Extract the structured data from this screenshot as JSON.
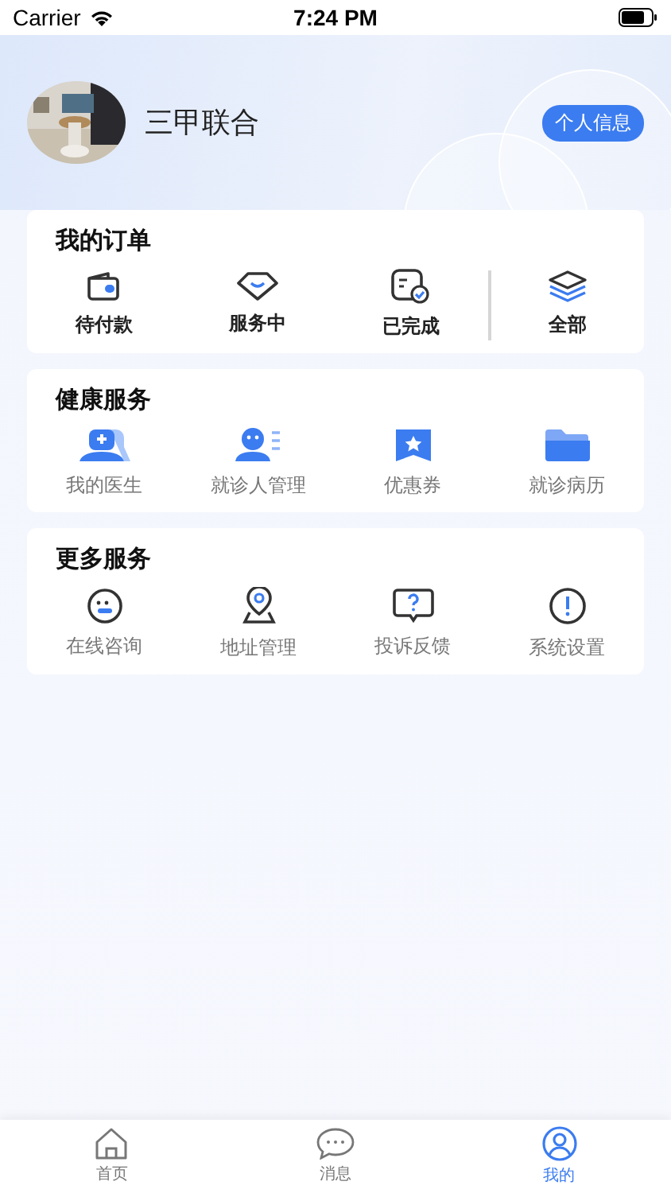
{
  "status_bar": {
    "carrier": "Carrier",
    "time": "7:24 PM"
  },
  "profile": {
    "name": "三甲联合",
    "button": "个人信息"
  },
  "orders": {
    "title": "我的订单",
    "items": [
      {
        "label": "待付款"
      },
      {
        "label": "服务中"
      },
      {
        "label": "已完成"
      },
      {
        "label": "全部"
      }
    ]
  },
  "health_services": {
    "title": "健康服务",
    "items": [
      {
        "label": "我的医生"
      },
      {
        "label": "就诊人管理"
      },
      {
        "label": "优惠券"
      },
      {
        "label": "就诊病历"
      }
    ]
  },
  "more_services": {
    "title": "更多服务",
    "items": [
      {
        "label": "在线咨询"
      },
      {
        "label": "地址管理"
      },
      {
        "label": "投诉反馈"
      },
      {
        "label": "系统设置"
      }
    ]
  },
  "tab_bar": [
    {
      "label": "首页",
      "selected": false
    },
    {
      "label": "消息",
      "selected": false
    },
    {
      "label": "我的",
      "selected": true
    }
  ]
}
